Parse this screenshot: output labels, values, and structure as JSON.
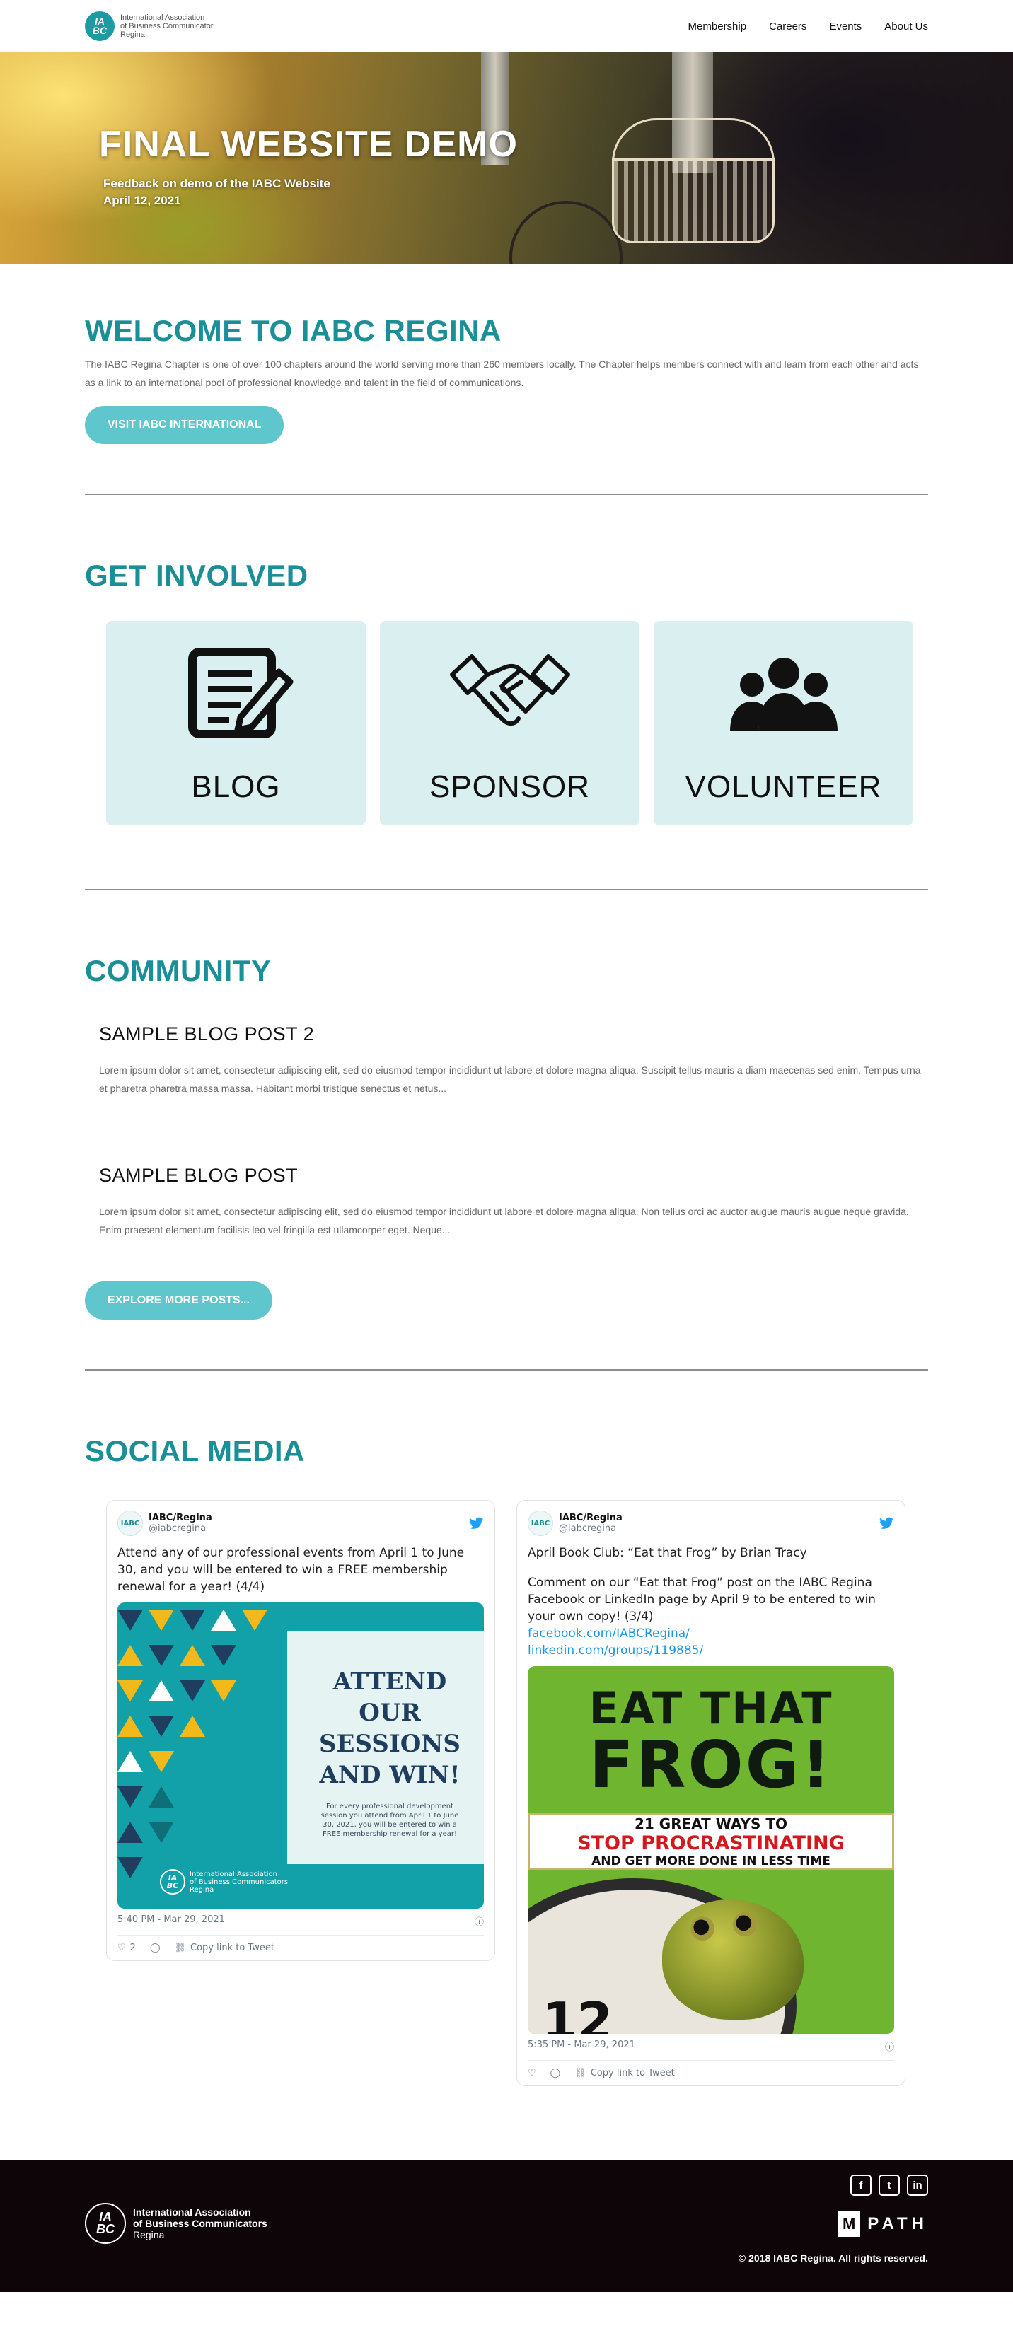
{
  "header": {
    "logo_line1": "International Association",
    "logo_line2": "of Business Communicator",
    "logo_line3": "Regina",
    "nav": [
      "Membership",
      "Careers",
      "Events",
      "About Us"
    ]
  },
  "hero": {
    "title": "FINAL WEBSITE DEMO",
    "subtitle": "Feedback on demo of the IABC Website",
    "date": "April 12, 2021"
  },
  "welcome": {
    "heading": "WELCOME TO IABC REGINA",
    "body": "The IABC Regina Chapter is one of over 100 chapters around the world serving more than 260 members locally. The Chapter helps members connect with and learn from each other and acts as a link to an international pool of professional knowledge and talent in the field of communications.",
    "button": "VISIT IABC INTERNATIONAL"
  },
  "involved": {
    "heading": "GET INVOLVED",
    "cards": [
      {
        "label": "BLOG",
        "icon": "blog-icon"
      },
      {
        "label": "SPONSOR",
        "icon": "handshake-icon"
      },
      {
        "label": "VOLUNTEER",
        "icon": "group-icon"
      }
    ]
  },
  "community": {
    "heading": "COMMUNITY",
    "posts": [
      {
        "title": "SAMPLE BLOG POST 2",
        "excerpt": "Lorem ipsum dolor sit amet, consectetur adipiscing elit, sed do eiusmod tempor incididunt ut labore et dolore magna aliqua. Suscipit tellus mauris a diam maecenas sed enim. Tempus urna et pharetra pharetra massa massa. Habitant morbi tristique senectus et netus..."
      },
      {
        "title": "SAMPLE BLOG POST",
        "excerpt": "Lorem ipsum dolor sit amet, consectetur adipiscing elit, sed do eiusmod tempor incididunt ut labore et dolore magna aliqua. Non tellus orci ac auctor augue mauris augue neque gravida. Enim praesent elementum facilisis leo vel fringilla est ullamcorper eget. Neque..."
      }
    ],
    "button": "EXPLORE MORE POSTS..."
  },
  "social": {
    "heading": "SOCIAL MEDIA",
    "tweets": [
      {
        "name": "IABC/Regina",
        "handle": "@iabcregina",
        "text": "Attend any of our professional events from April 1 to June 30, and you will be entered to win a FREE membership renewal for a year! (4/4)",
        "media": {
          "headline_lines": [
            "ATTEND",
            "OUR",
            "SESSIONS",
            "AND WIN!"
          ],
          "small": "For every professional development session you attend from April 1 to June 30, 2021, you will be entered to win a FREE membership renewal for a year!",
          "logo_line1": "International Association",
          "logo_line2": "of Business Communicators",
          "logo_line3": "Regina"
        },
        "time": "5:40 PM - Mar 29, 2021",
        "likes": "2",
        "copy_link": "Copy link to Tweet"
      },
      {
        "name": "IABC/Regina",
        "handle": "@iabcregina",
        "text": "April Book Club: “Eat that Frog” by Brian Tracy",
        "text2": "Comment on our “Eat that Frog” post on the IABC Regina Facebook or LinkedIn page by April 9 to be entered to win your own copy! (3/4)",
        "link1": "facebook.com/IABCRegina/",
        "link2": "linkedin.com/groups/119885/",
        "media": {
          "eat": "EAT THAT",
          "frog": "FROG!",
          "band1": "21 GREAT WAYS TO",
          "band2": "STOP PROCRASTINATING",
          "band3": "AND GET MORE DONE IN LESS TIME",
          "clock_num": "12"
        },
        "time": "5:35 PM - Mar 29, 2021",
        "copy_link": "Copy link to Tweet"
      }
    ]
  },
  "footer": {
    "logo_line1": "International Association",
    "logo_line2": "of Business Communicators",
    "logo_line3": "Regina",
    "social_icons": [
      "facebook-icon",
      "twitter-icon",
      "linkedin-icon"
    ],
    "mpath": "PATH",
    "mpath_m": "M",
    "copyright": "© 2018 IABC Regina. All rights reserved."
  },
  "colors": {
    "teal": "#1b8f98",
    "button": "#5ec6cc",
    "card": "#daeff0",
    "footer": "#0e0508"
  }
}
